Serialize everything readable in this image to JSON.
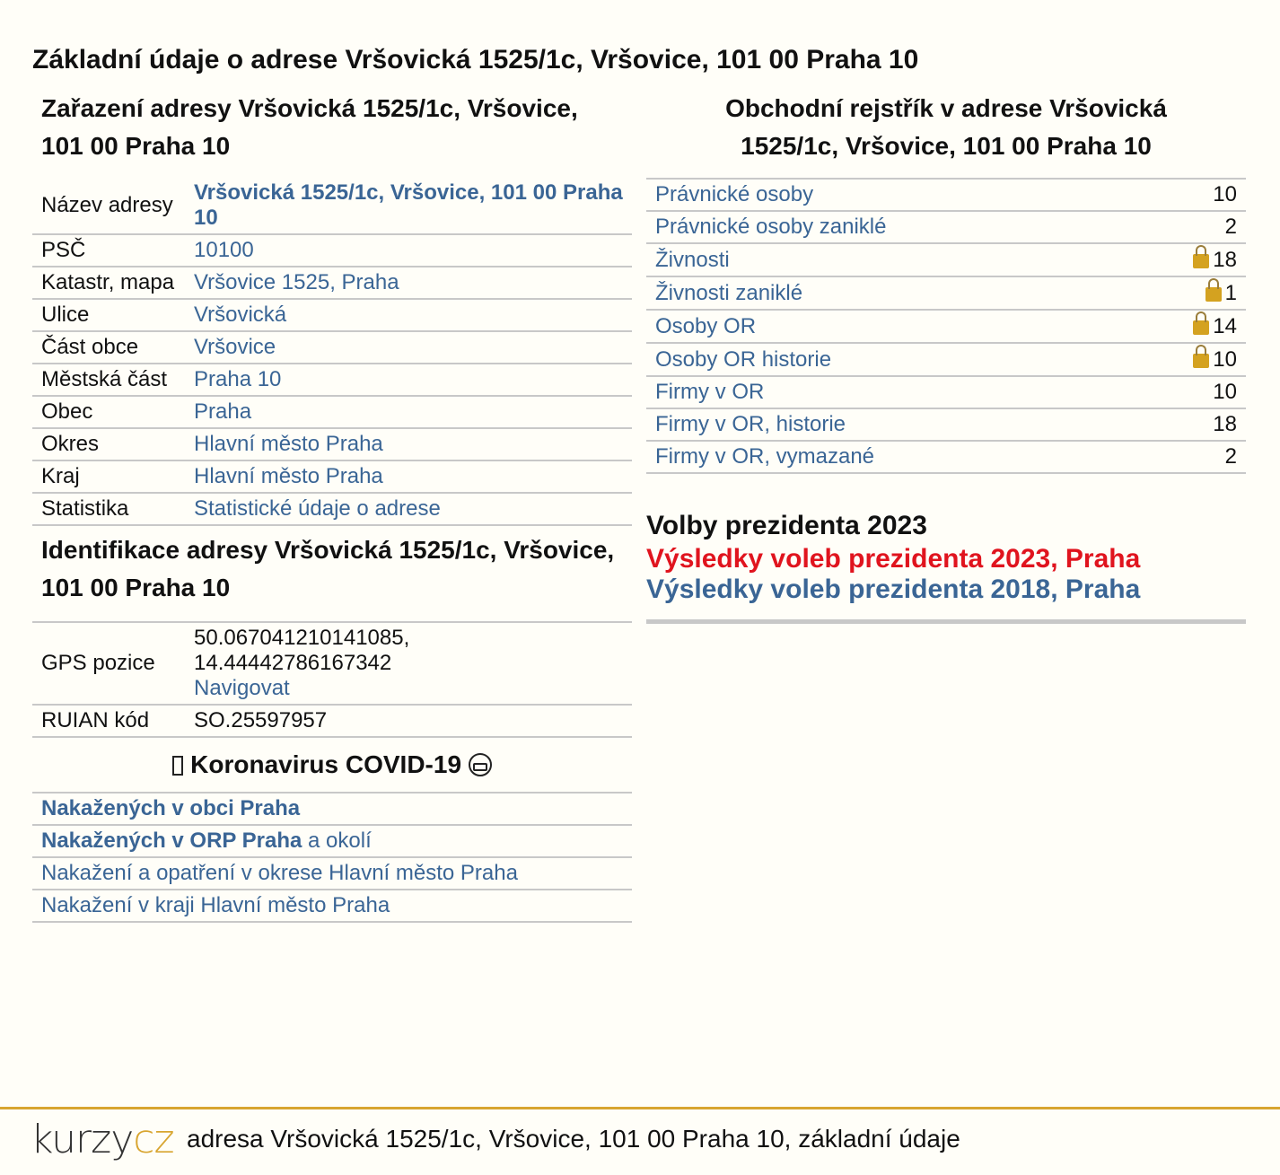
{
  "page_title": "Základní údaje o adrese Vršovická 1525/1c, Vršovice, 101 00 Praha 10",
  "zarazeni": {
    "title": "Zařazení adresy Vršovická 1525/1c, Vršovice, 101 00 Praha 10",
    "rows": [
      {
        "label": "Název adresy",
        "value": "Vršovická 1525/1c, Vršovice, 101 00 Praha 10"
      },
      {
        "label": "PSČ",
        "value": "10100"
      },
      {
        "label": "Katastr, mapa",
        "value": "Vršovice 1525, Praha"
      },
      {
        "label": "Ulice",
        "value": "Vršovická"
      },
      {
        "label": "Část obce",
        "value": "Vršovice"
      },
      {
        "label": "Městská část",
        "value": "Praha 10"
      },
      {
        "label": "Obec",
        "value": "Praha"
      },
      {
        "label": "Okres",
        "value": "Hlavní město Praha"
      },
      {
        "label": "Kraj",
        "value": "Hlavní město Praha"
      },
      {
        "label": "Statistika",
        "value": "Statistické údaje o adrese"
      }
    ]
  },
  "identifikace": {
    "title": "Identifikace adresy Vršovická 1525/1c, Vršovice, 101 00 Praha 10",
    "gps_label": "GPS pozice",
    "gps_line1": "50.067041210141085,",
    "gps_line2": "14.44442786167342",
    "navigate": "Navigovat",
    "ruian_label": "RUIAN kód",
    "ruian_value": "SO.25597957"
  },
  "covid": {
    "title": "Koronavirus COVID-19",
    "links": [
      {
        "bold": "Nakažených v obci Praha",
        "rest": ""
      },
      {
        "bold": "Nakažených v ORP Praha",
        "rest": " a okolí"
      },
      {
        "bold": "",
        "rest": "Nakažení a opatření v okrese Hlavní město Praha"
      },
      {
        "bold": "",
        "rest": "Nakažení v kraji Hlavní město Praha"
      }
    ]
  },
  "obchodni": {
    "title": "Obchodní rejstřík v adrese Vršovická 1525/1c, Vršovice, 101 00 Praha 10",
    "rows": [
      {
        "label": "Právnické osoby",
        "count": "10",
        "locked": false
      },
      {
        "label": "Právnické osoby zaniklé",
        "count": "2",
        "locked": false
      },
      {
        "label": "Živnosti",
        "count": "18",
        "locked": true
      },
      {
        "label": "Živnosti zaniklé",
        "count": "1",
        "locked": true
      },
      {
        "label": "Osoby OR",
        "count": "14",
        "locked": true
      },
      {
        "label": "Osoby OR historie",
        "count": "10",
        "locked": true
      },
      {
        "label": "Firmy v OR",
        "count": "10",
        "locked": false
      },
      {
        "label": "Firmy v OR, historie",
        "count": "18",
        "locked": false
      },
      {
        "label": "Firmy v OR, vymazané",
        "count": "2",
        "locked": false
      }
    ]
  },
  "volby": {
    "title": "Volby prezidenta 2023",
    "link_2023": "Výsledky voleb prezidenta 2023, Praha",
    "link_2018": "Výsledky voleb prezidenta 2018, Praha"
  },
  "footer": {
    "logo_k": "kurzy",
    "logo_c": "cz",
    "text": "adresa Vršovická 1525/1c, Vršovice, 101 00 Praha 10, základní údaje"
  },
  "colors": {
    "link": "#3a6595",
    "accent": "#d8a530",
    "red": "#e0141e"
  }
}
